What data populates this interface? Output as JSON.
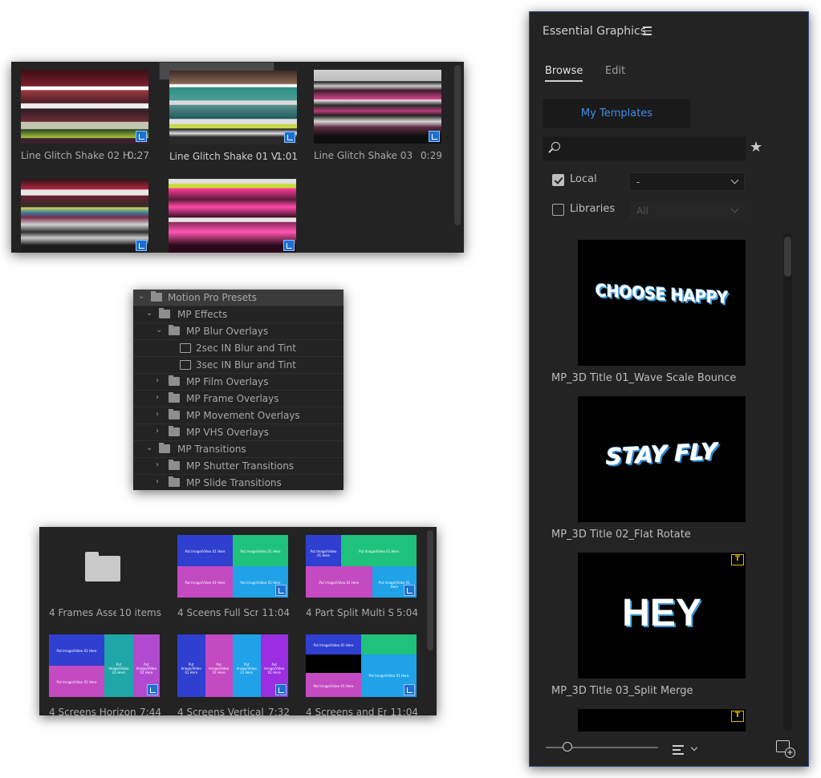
{
  "glitch_panel": {
    "items": [
      {
        "name": "Line Glitch Shake 02 H...",
        "duration": "0:27"
      },
      {
        "name": "Line Glitch Shake 01 V...",
        "duration": "1:01"
      },
      {
        "name": "Line Glitch Shake 03",
        "duration": "0:29"
      },
      {
        "name": "",
        "duration": ""
      },
      {
        "name": "",
        "duration": ""
      }
    ]
  },
  "presets_tree": {
    "rows": [
      {
        "label": "Motion Pro Presets"
      },
      {
        "label": "MP Effects"
      },
      {
        "label": "MP Blur Overlays"
      },
      {
        "label": "2sec IN Blur and Tint"
      },
      {
        "label": "3sec IN Blur and Tint"
      },
      {
        "label": "MP Film Overlays"
      },
      {
        "label": "MP Frame Overlays"
      },
      {
        "label": "MP Movement Overlays"
      },
      {
        "label": "MP VHS Overlays"
      },
      {
        "label": "MP Transitions"
      },
      {
        "label": "MP Shutter Transitions"
      },
      {
        "label": "MP Slide Transitions"
      }
    ]
  },
  "frames_panel": {
    "items": [
      {
        "name": "4 Frames Assets",
        "duration": "10 items"
      },
      {
        "name": "4 Sceens Full Scr...",
        "duration": "11:04"
      },
      {
        "name": "4 Part Split Multi Si...",
        "duration": "5:04"
      },
      {
        "name": "4 Screens Horizont...",
        "duration": "7:44"
      },
      {
        "name": "4 Screens Vertical",
        "duration": "7:32"
      },
      {
        "name": "4 Screens and Em...",
        "duration": "11:04"
      }
    ],
    "placeholder_text": "Put Image/Video 01 Here"
  },
  "essential_graphics": {
    "title": "Essential Graphics",
    "tabs": {
      "browse": "Browse",
      "edit": "Edit"
    },
    "my_templates": "My Templates",
    "search_placeholder": "",
    "local_label": "Local",
    "local_value": "-",
    "libraries_label": "Libraries",
    "libraries_value": "All",
    "templates": [
      {
        "name": "MP_3D Title 01_Wave Scale Bounce",
        "preview": "CHOOSE HAPPY"
      },
      {
        "name": "MP_3D Title 02_Flat Rotate",
        "preview": "STAY FLY"
      },
      {
        "name": "MP_3D Title 03_Split Merge",
        "preview": "HEY"
      }
    ]
  },
  "colors": {
    "panel_bg": "#232323",
    "accent_blue": "#3f8ee8",
    "warning_yellow": "#e6b800"
  }
}
